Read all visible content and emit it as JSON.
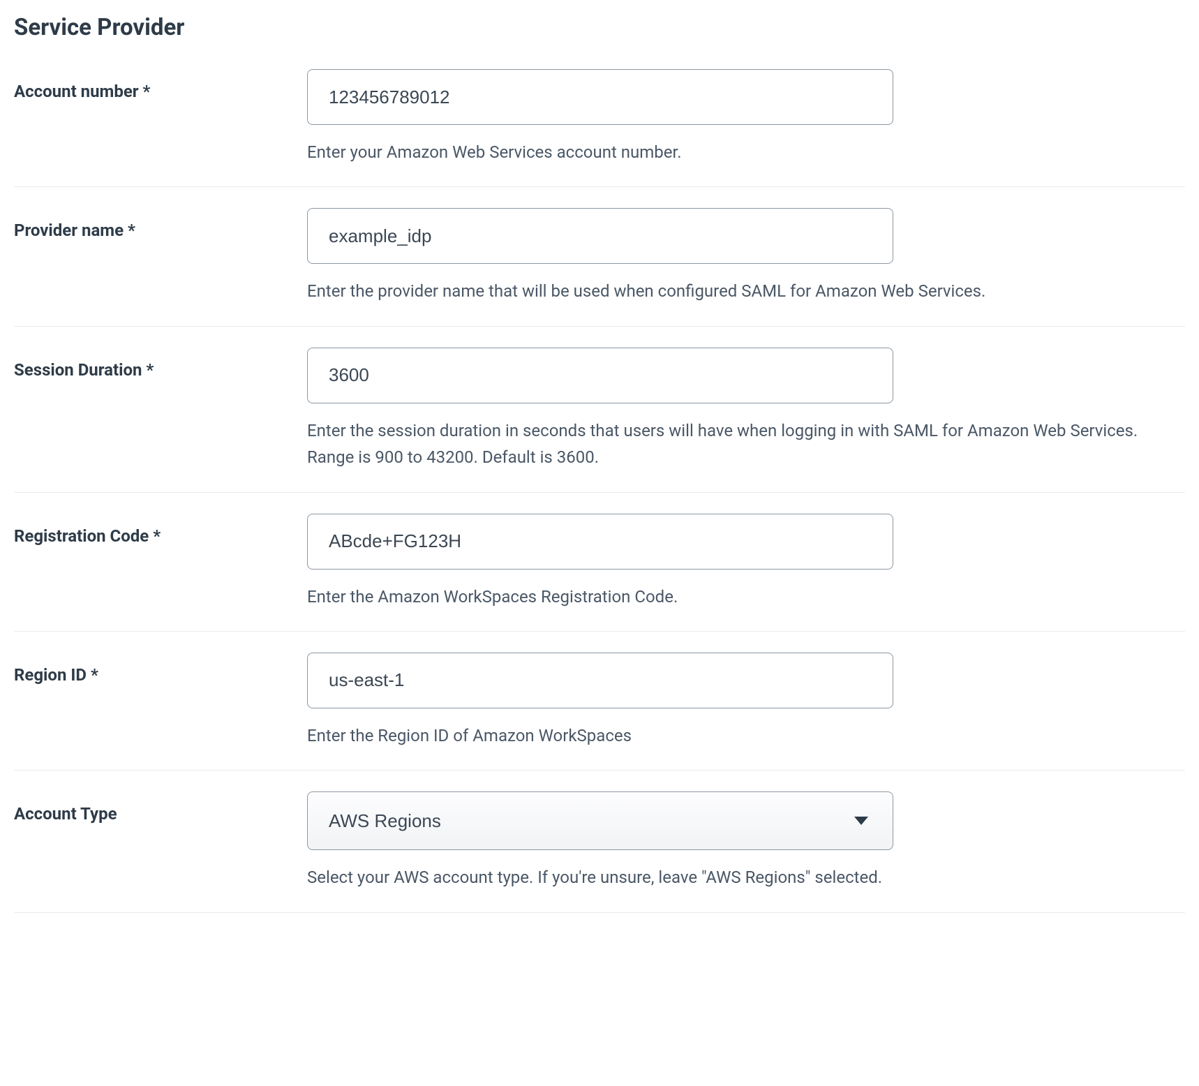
{
  "section_title": "Service Provider",
  "fields": {
    "account_number": {
      "label": "Account number *",
      "value": "123456789012",
      "help": "Enter your Amazon Web Services account number."
    },
    "provider_name": {
      "label": "Provider name *",
      "value": "example_idp",
      "help": "Enter the provider name that will be used when configured SAML for Amazon Web Services."
    },
    "session_duration": {
      "label": "Session Duration *",
      "value": "3600",
      "help": "Enter the session duration in seconds that users will have when logging in with SAML for Amazon Web Services. Range is 900 to 43200. Default is 3600."
    },
    "registration_code": {
      "label": "Registration Code *",
      "value": "ABcde+FG123H",
      "help": "Enter the Amazon WorkSpaces Registration Code."
    },
    "region_id": {
      "label": "Region ID *",
      "value": "us-east-1",
      "help": "Enter the Region ID of Amazon WorkSpaces"
    },
    "account_type": {
      "label": "Account Type",
      "value": "AWS Regions",
      "help": "Select your AWS account type. If you're unsure, leave \"AWS Regions\" selected."
    }
  }
}
